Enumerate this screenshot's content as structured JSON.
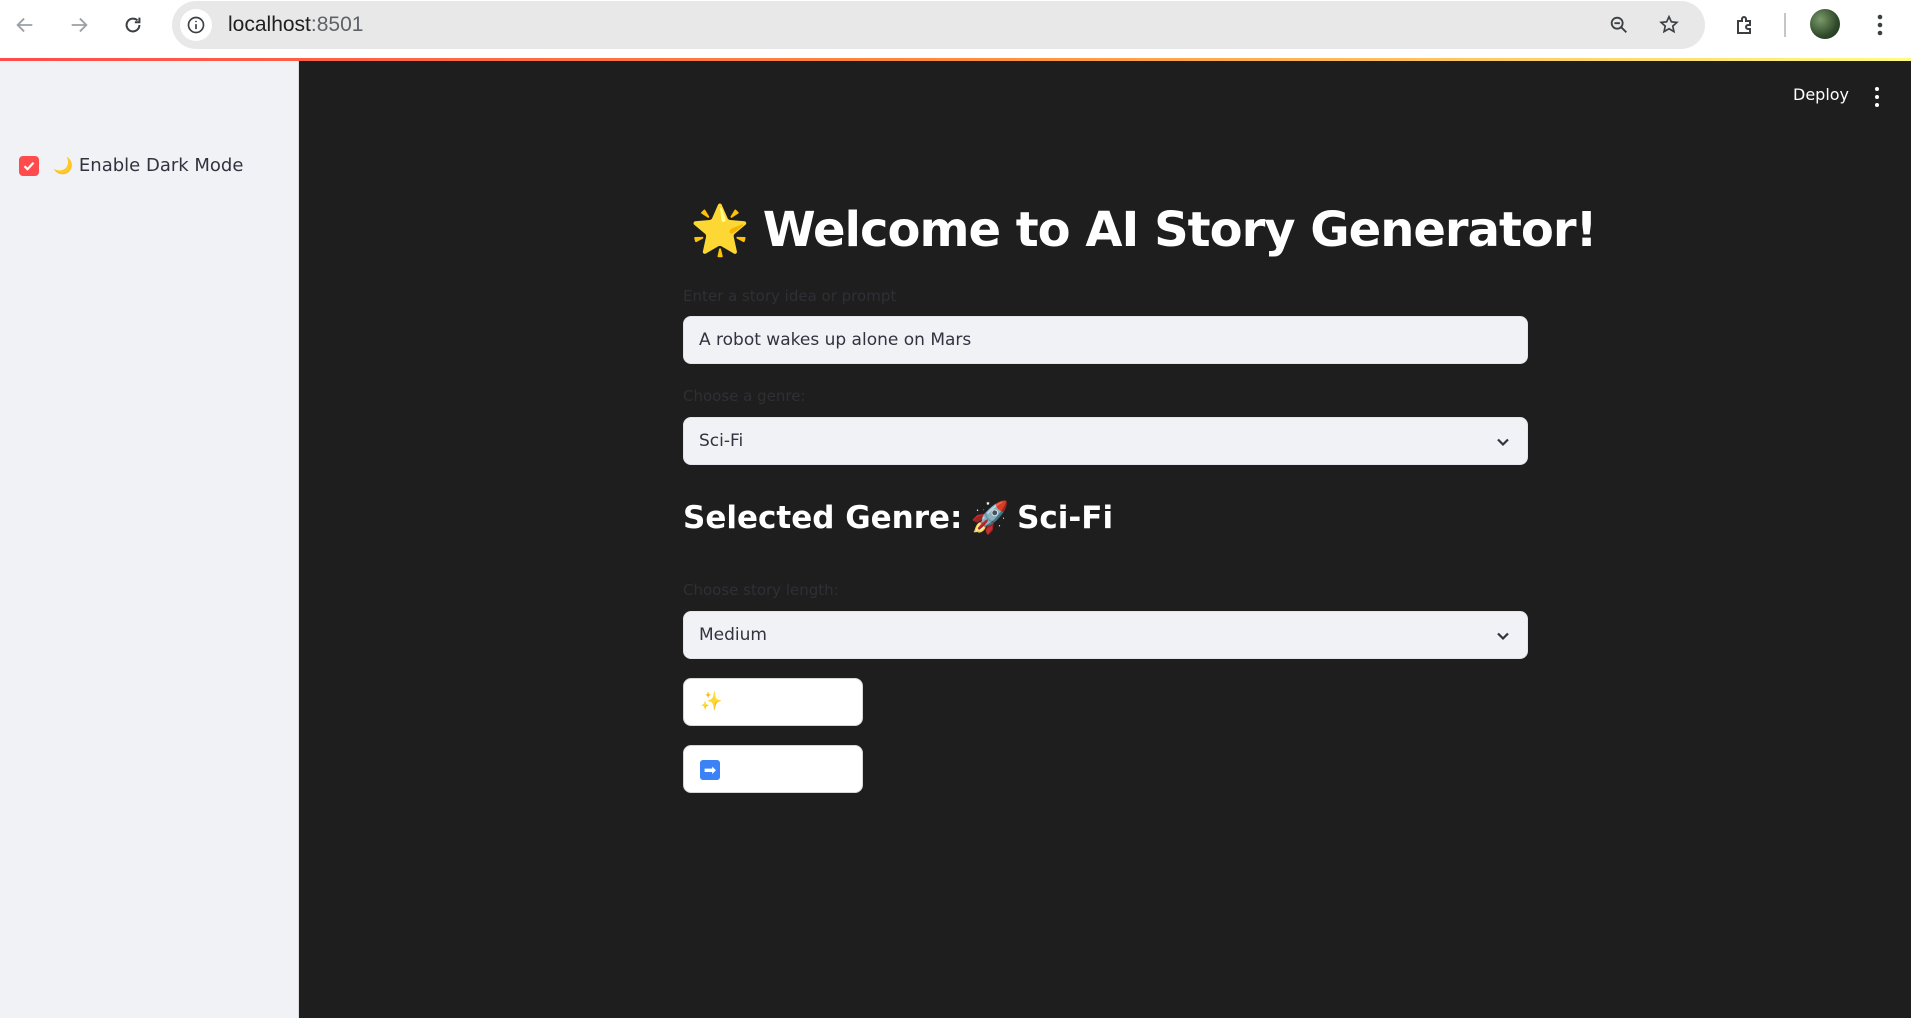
{
  "browser": {
    "url_host": "localhost",
    "url_port": ":8501"
  },
  "sidebar": {
    "dark_mode": {
      "icon": "🌙",
      "label": "Enable Dark Mode",
      "checked": true
    }
  },
  "header": {
    "deploy_label": "Deploy"
  },
  "main": {
    "title_emoji": "🌟",
    "title": "Welcome to AI Story Generator!",
    "prompt": {
      "label": "Enter a story idea or prompt",
      "value": "A robot wakes up alone on Mars"
    },
    "genre": {
      "label": "Choose a genre:",
      "value": "Sci-Fi"
    },
    "selected_genre": {
      "prefix": "Selected Genre:",
      "emoji": "🚀",
      "value": "Sci-Fi"
    },
    "length": {
      "label": "Choose story length:",
      "value": "Medium"
    },
    "buttons": {
      "generate_icon": "✨",
      "next_icon": "➡"
    }
  },
  "colors": {
    "accent": "#ff4b4b",
    "main_bg": "#1e1e1e",
    "sidebar_bg": "#f0f2f6"
  }
}
